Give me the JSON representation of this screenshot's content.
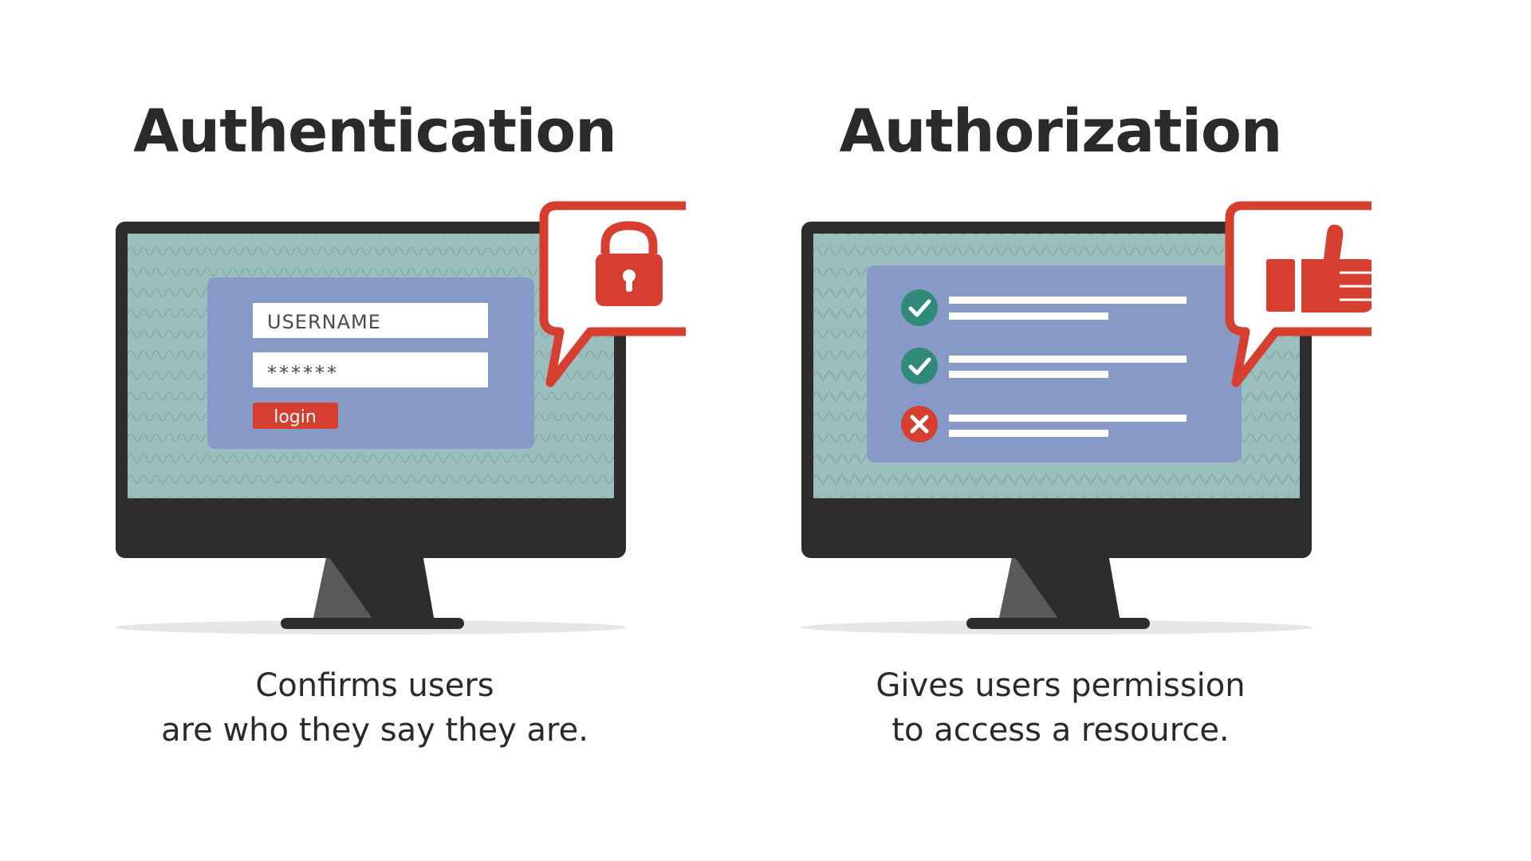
{
  "authentication": {
    "title": "Authentication",
    "caption_line1": "Confirms users",
    "caption_line2": "are who they say they are.",
    "username_placeholder": "USERNAME",
    "password_mask": "******",
    "login_label": "login"
  },
  "authorization": {
    "title": "Authorization",
    "caption_line1": "Gives users permission",
    "caption_line2": "to access a resource."
  },
  "colors": {
    "accent_red": "#d63f2f",
    "monitor_dark": "#2f2d2c",
    "screen_teal": "#9bbfbc",
    "dialog_blue": "#8799c6",
    "check_green": "#2f8a7a",
    "text_dark": "#2b2a29"
  },
  "icons": {
    "auth_bubble": "padlock-icon",
    "authz_bubble": "thumbs-up-icon",
    "granted": "check-circle-icon",
    "denied": "x-circle-icon"
  }
}
